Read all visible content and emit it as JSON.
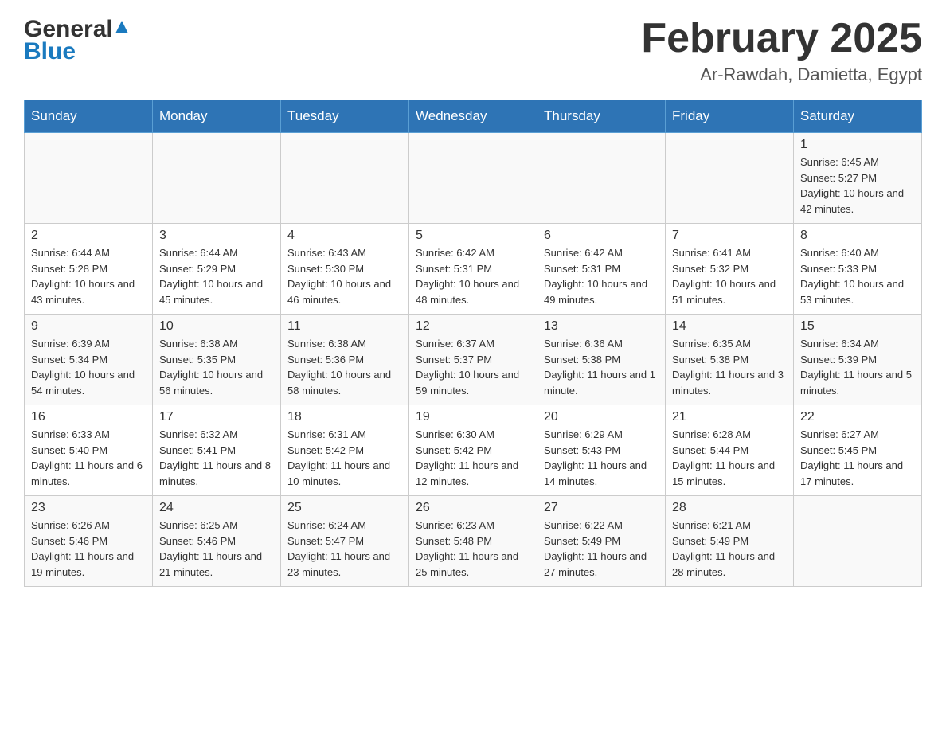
{
  "header": {
    "logo_general": "General",
    "logo_blue": "Blue",
    "title": "February 2025",
    "subtitle": "Ar-Rawdah, Damietta, Egypt"
  },
  "weekdays": [
    "Sunday",
    "Monday",
    "Tuesday",
    "Wednesday",
    "Thursday",
    "Friday",
    "Saturday"
  ],
  "weeks": [
    [
      {
        "day": "",
        "info": ""
      },
      {
        "day": "",
        "info": ""
      },
      {
        "day": "",
        "info": ""
      },
      {
        "day": "",
        "info": ""
      },
      {
        "day": "",
        "info": ""
      },
      {
        "day": "",
        "info": ""
      },
      {
        "day": "1",
        "info": "Sunrise: 6:45 AM\nSunset: 5:27 PM\nDaylight: 10 hours and 42 minutes."
      }
    ],
    [
      {
        "day": "2",
        "info": "Sunrise: 6:44 AM\nSunset: 5:28 PM\nDaylight: 10 hours and 43 minutes."
      },
      {
        "day": "3",
        "info": "Sunrise: 6:44 AM\nSunset: 5:29 PM\nDaylight: 10 hours and 45 minutes."
      },
      {
        "day": "4",
        "info": "Sunrise: 6:43 AM\nSunset: 5:30 PM\nDaylight: 10 hours and 46 minutes."
      },
      {
        "day": "5",
        "info": "Sunrise: 6:42 AM\nSunset: 5:31 PM\nDaylight: 10 hours and 48 minutes."
      },
      {
        "day": "6",
        "info": "Sunrise: 6:42 AM\nSunset: 5:31 PM\nDaylight: 10 hours and 49 minutes."
      },
      {
        "day": "7",
        "info": "Sunrise: 6:41 AM\nSunset: 5:32 PM\nDaylight: 10 hours and 51 minutes."
      },
      {
        "day": "8",
        "info": "Sunrise: 6:40 AM\nSunset: 5:33 PM\nDaylight: 10 hours and 53 minutes."
      }
    ],
    [
      {
        "day": "9",
        "info": "Sunrise: 6:39 AM\nSunset: 5:34 PM\nDaylight: 10 hours and 54 minutes."
      },
      {
        "day": "10",
        "info": "Sunrise: 6:38 AM\nSunset: 5:35 PM\nDaylight: 10 hours and 56 minutes."
      },
      {
        "day": "11",
        "info": "Sunrise: 6:38 AM\nSunset: 5:36 PM\nDaylight: 10 hours and 58 minutes."
      },
      {
        "day": "12",
        "info": "Sunrise: 6:37 AM\nSunset: 5:37 PM\nDaylight: 10 hours and 59 minutes."
      },
      {
        "day": "13",
        "info": "Sunrise: 6:36 AM\nSunset: 5:38 PM\nDaylight: 11 hours and 1 minute."
      },
      {
        "day": "14",
        "info": "Sunrise: 6:35 AM\nSunset: 5:38 PM\nDaylight: 11 hours and 3 minutes."
      },
      {
        "day": "15",
        "info": "Sunrise: 6:34 AM\nSunset: 5:39 PM\nDaylight: 11 hours and 5 minutes."
      }
    ],
    [
      {
        "day": "16",
        "info": "Sunrise: 6:33 AM\nSunset: 5:40 PM\nDaylight: 11 hours and 6 minutes."
      },
      {
        "day": "17",
        "info": "Sunrise: 6:32 AM\nSunset: 5:41 PM\nDaylight: 11 hours and 8 minutes."
      },
      {
        "day": "18",
        "info": "Sunrise: 6:31 AM\nSunset: 5:42 PM\nDaylight: 11 hours and 10 minutes."
      },
      {
        "day": "19",
        "info": "Sunrise: 6:30 AM\nSunset: 5:42 PM\nDaylight: 11 hours and 12 minutes."
      },
      {
        "day": "20",
        "info": "Sunrise: 6:29 AM\nSunset: 5:43 PM\nDaylight: 11 hours and 14 minutes."
      },
      {
        "day": "21",
        "info": "Sunrise: 6:28 AM\nSunset: 5:44 PM\nDaylight: 11 hours and 15 minutes."
      },
      {
        "day": "22",
        "info": "Sunrise: 6:27 AM\nSunset: 5:45 PM\nDaylight: 11 hours and 17 minutes."
      }
    ],
    [
      {
        "day": "23",
        "info": "Sunrise: 6:26 AM\nSunset: 5:46 PM\nDaylight: 11 hours and 19 minutes."
      },
      {
        "day": "24",
        "info": "Sunrise: 6:25 AM\nSunset: 5:46 PM\nDaylight: 11 hours and 21 minutes."
      },
      {
        "day": "25",
        "info": "Sunrise: 6:24 AM\nSunset: 5:47 PM\nDaylight: 11 hours and 23 minutes."
      },
      {
        "day": "26",
        "info": "Sunrise: 6:23 AM\nSunset: 5:48 PM\nDaylight: 11 hours and 25 minutes."
      },
      {
        "day": "27",
        "info": "Sunrise: 6:22 AM\nSunset: 5:49 PM\nDaylight: 11 hours and 27 minutes."
      },
      {
        "day": "28",
        "info": "Sunrise: 6:21 AM\nSunset: 5:49 PM\nDaylight: 11 hours and 28 minutes."
      },
      {
        "day": "",
        "info": ""
      }
    ]
  ]
}
